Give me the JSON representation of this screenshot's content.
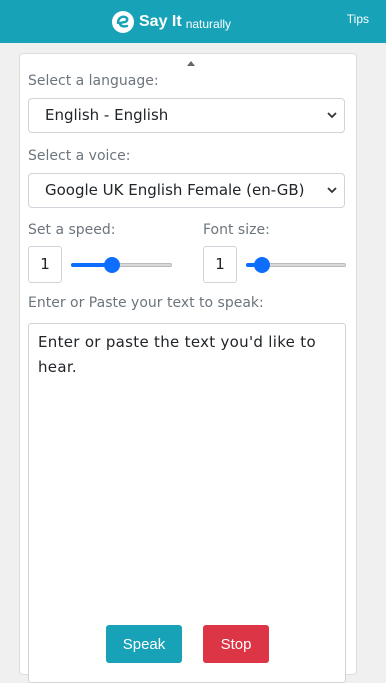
{
  "header": {
    "logo_main": "Say It",
    "logo_sub": "naturally",
    "tips": "Tips"
  },
  "form": {
    "language_label": "Select a language:",
    "language_value": "English - English",
    "voice_label": "Select a voice:",
    "voice_value": "Google UK English Female (en-GB)",
    "speed_label": "Set a speed:",
    "speed_value": "1",
    "speed_slider_fraction": 0.39,
    "font_label": "Font size:",
    "font_value": "1",
    "font_slider_fraction": 0.1,
    "text_label": "Enter or Paste your text to speak:",
    "text_placeholder": "Enter or paste the text you'd like to hear."
  },
  "buttons": {
    "speak": "Speak",
    "stop": "Stop"
  },
  "colors": {
    "header": "#17a2b8",
    "speak": "#17a2b8",
    "stop": "#dc3545",
    "slider": "#0d6efd"
  }
}
